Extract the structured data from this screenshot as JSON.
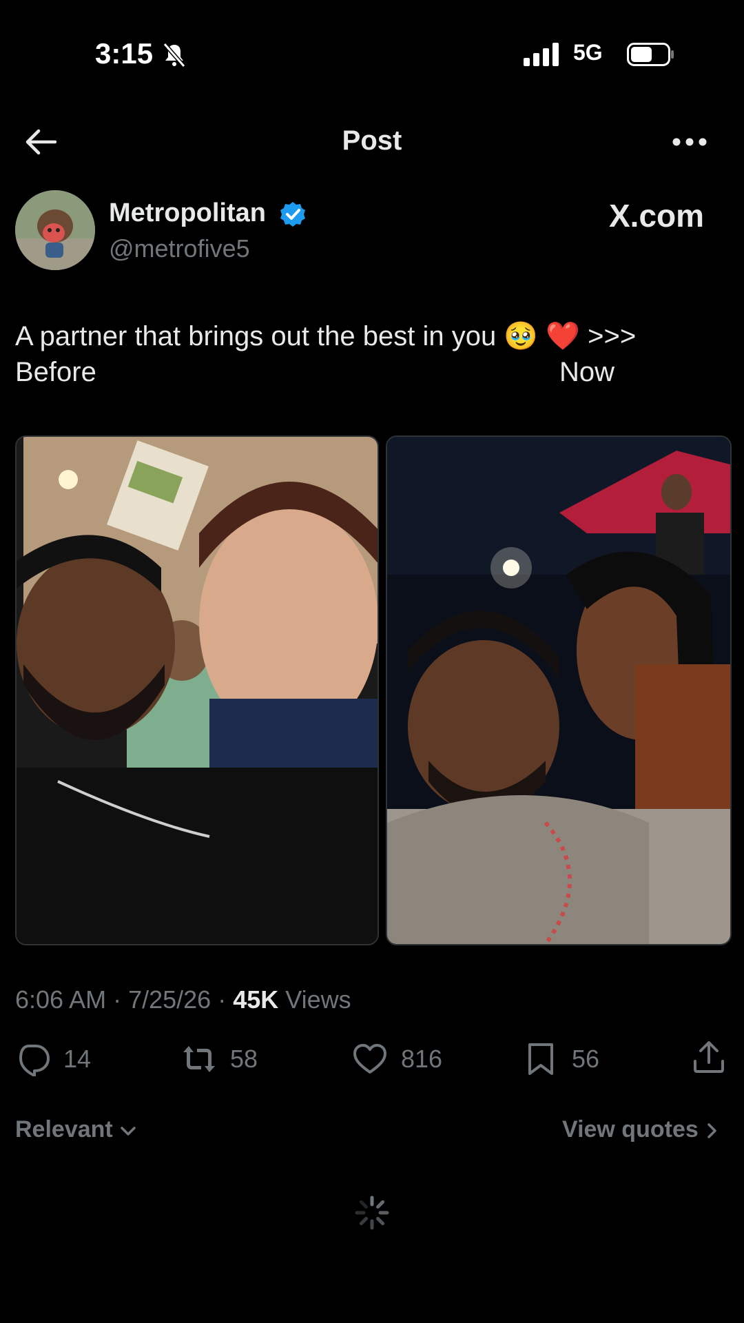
{
  "status_bar": {
    "time": "3:15",
    "network": "5G",
    "icons": [
      "bell-muted-icon",
      "signal-icon",
      "battery-icon"
    ]
  },
  "header": {
    "title": "Post",
    "back_icon": "arrow-left-icon",
    "more_icon": "more-icon"
  },
  "author": {
    "name": "Metropolitan",
    "handle": "@metrofive5",
    "verified": true,
    "site_label": "X.com"
  },
  "post": {
    "text": "A partner that brings out the best in you 🥹 ❤️ >>>",
    "label_before": "Before",
    "label_now": "Now"
  },
  "meta": {
    "time": "6:06 AM",
    "date": "7/25/26",
    "views_count": "45K",
    "views_label": "Views"
  },
  "actions": {
    "replies": "14",
    "reposts": "58",
    "likes": "816",
    "bookmarks": "56"
  },
  "footer": {
    "sort_label": "Relevant",
    "view_quotes": "View quotes"
  },
  "colors": {
    "background": "#000000",
    "text": "#e7e9ea",
    "muted": "#71767b",
    "verified": "#1d9bf0"
  }
}
